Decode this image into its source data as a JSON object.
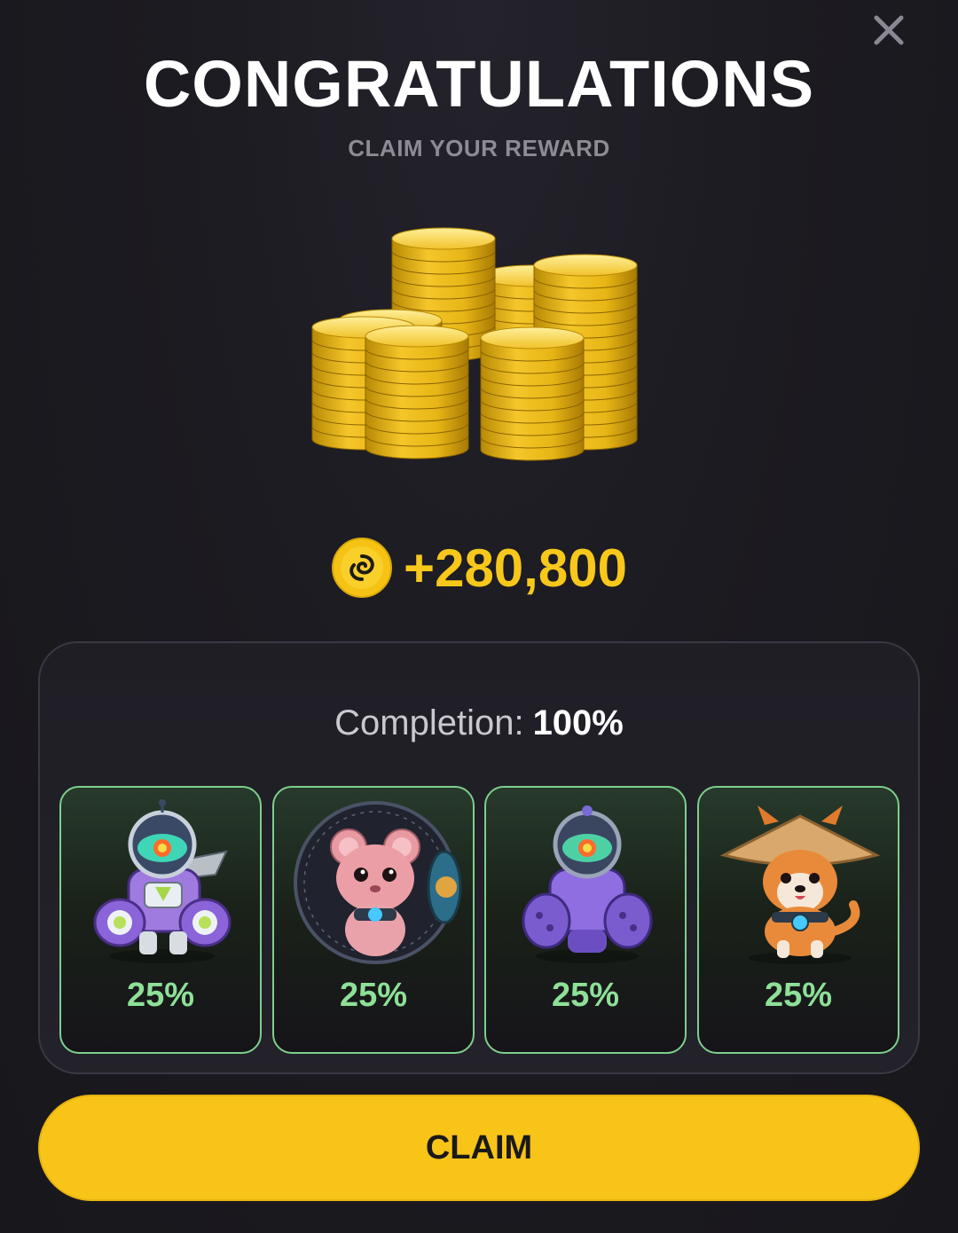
{
  "header": {
    "title": "CONGRATULATIONS",
    "subtitle": "CLAIM YOUR REWARD",
    "close_icon": "close-icon"
  },
  "reward": {
    "image": "coin-stacks",
    "coin_icon": "spiral-coin-icon",
    "amount": "+280,800"
  },
  "completion": {
    "label": "Completion:",
    "value": "100%"
  },
  "cards": [
    {
      "character": "robot-mech-icon",
      "percent": "25%"
    },
    {
      "character": "hamster-ball-icon",
      "percent": "25%"
    },
    {
      "character": "robot-mech-purple-icon",
      "percent": "25%"
    },
    {
      "character": "shiba-hat-icon",
      "percent": "25%"
    }
  ],
  "claim_button": {
    "label": "CLAIM"
  },
  "colors": {
    "accent_yellow": "#f8c417",
    "amount_gold": "#f7c81b",
    "card_green": "#7dcf8c",
    "percent_green": "#8ee098"
  }
}
